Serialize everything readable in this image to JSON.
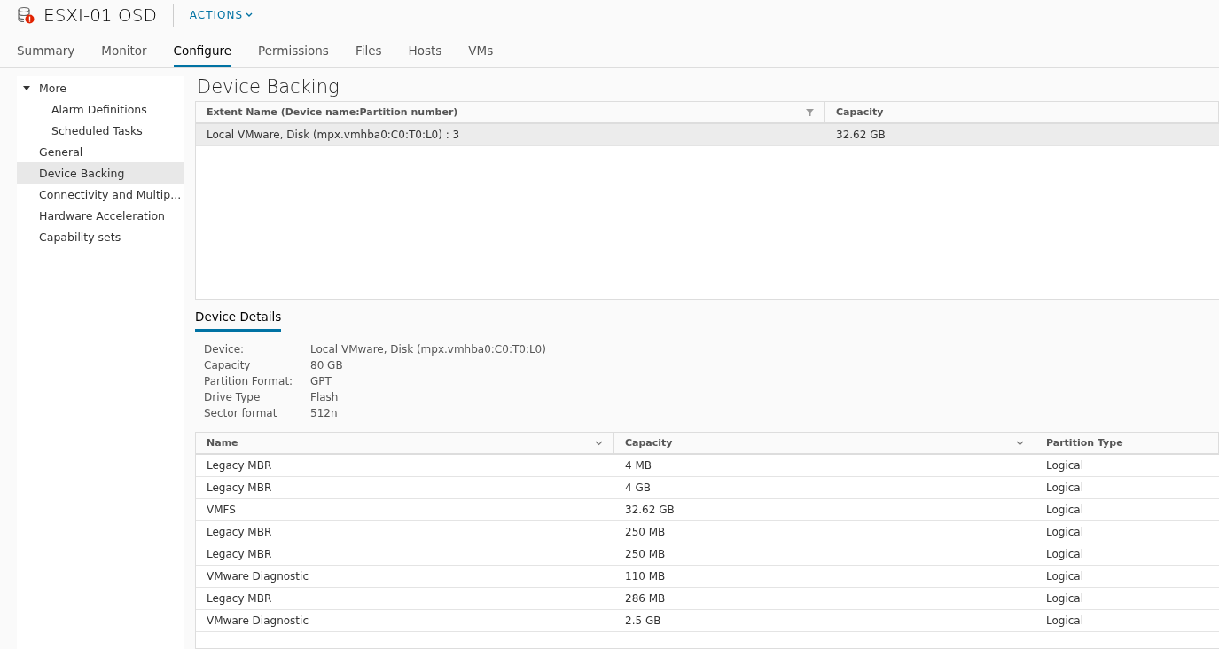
{
  "header": {
    "title": "ESXI-01 OSD",
    "actions": "ACTIONS"
  },
  "tabs": [
    {
      "label": "Summary",
      "selected": false
    },
    {
      "label": "Monitor",
      "selected": false
    },
    {
      "label": "Configure",
      "selected": true
    },
    {
      "label": "Permissions",
      "selected": false
    },
    {
      "label": "Files",
      "selected": false
    },
    {
      "label": "Hosts",
      "selected": false
    },
    {
      "label": "VMs",
      "selected": false
    }
  ],
  "sidebar": {
    "items": [
      {
        "label": "More",
        "expanded": true,
        "selected": false,
        "children": [
          {
            "label": "Alarm Definitions",
            "selected": false
          },
          {
            "label": "Scheduled Tasks",
            "selected": false
          }
        ]
      },
      {
        "label": "General",
        "selected": false
      },
      {
        "label": "Device Backing",
        "selected": true
      },
      {
        "label": "Connectivity and Multip...",
        "selected": false
      },
      {
        "label": "Hardware Acceleration",
        "selected": false
      },
      {
        "label": "Capability sets",
        "selected": false
      }
    ]
  },
  "page_title": "Device Backing",
  "extents_table": {
    "columns": [
      "Extent Name (Device name:Partition number)",
      "Capacity"
    ],
    "rows": [
      {
        "cells": [
          "Local VMware, Disk (mpx.vmhba0:C0:T0:L0) : 3",
          "32.62 GB"
        ],
        "selected": true
      }
    ]
  },
  "details_tab": {
    "label": "Device Details",
    "selected": true
  },
  "details": [
    {
      "label": "Device:",
      "value": "Local VMware, Disk (mpx.vmhba0:C0:T0:L0)"
    },
    {
      "label": "Capacity",
      "value": "80 GB"
    },
    {
      "label": "Partition Format:",
      "value": "GPT"
    },
    {
      "label": "Drive Type",
      "value": "Flash"
    },
    {
      "label": "Sector format",
      "value": "512n"
    }
  ],
  "partitions_table": {
    "columns": [
      "Name",
      "Capacity",
      "Partition Type"
    ],
    "rows": [
      [
        "Legacy MBR",
        "4 MB",
        "Logical"
      ],
      [
        "Legacy MBR",
        "4 GB",
        "Logical"
      ],
      [
        "VMFS",
        "32.62 GB",
        "Logical"
      ],
      [
        "Legacy MBR",
        "250 MB",
        "Logical"
      ],
      [
        "Legacy MBR",
        "250 MB",
        "Logical"
      ],
      [
        "VMware Diagnostic",
        "110 MB",
        "Logical"
      ],
      [
        "Legacy MBR",
        "286 MB",
        "Logical"
      ],
      [
        "VMware Diagnostic",
        "2.5 GB",
        "Logical"
      ]
    ]
  }
}
